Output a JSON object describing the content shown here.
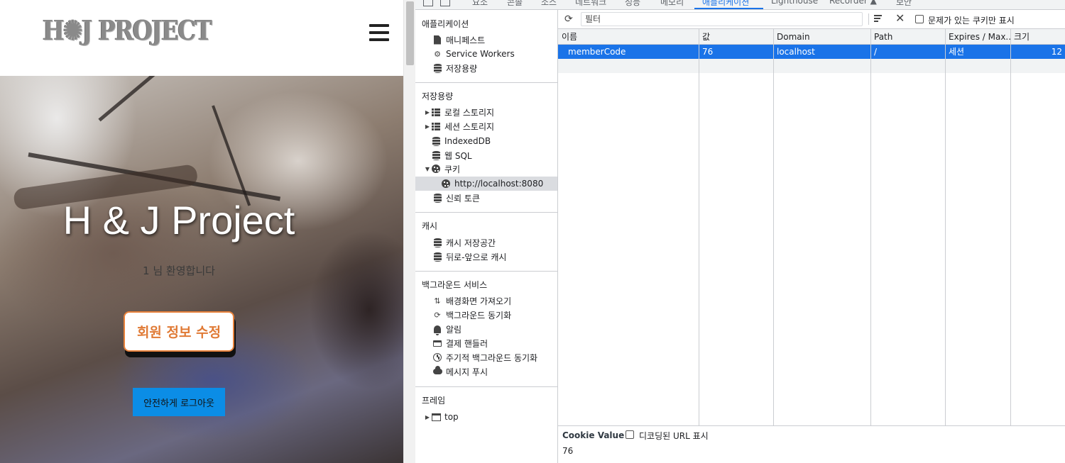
{
  "site": {
    "logo_text": "H✺J PROJECT",
    "hero_title": "H & J Project",
    "welcome": "1 님 환영합니다",
    "edit_button": "회원 정보 수정",
    "logout_button": "안전하게 로그아웃"
  },
  "devtools": {
    "tabs": [
      "요소",
      "콘솔",
      "소스",
      "네트워크",
      "성능",
      "메모리",
      "애플리케이션",
      "Lighthouse",
      "Recorder ▲",
      "보안"
    ],
    "active_tab": "애플리케이션",
    "sidebar": {
      "app_title": "애플리케이션",
      "app_items": [
        "매니페스트",
        "Service Workers",
        "저장용량"
      ],
      "storage_title": "저장용량",
      "storage_items": [
        "로컬 스토리지",
        "세션 스토리지",
        "IndexedDB",
        "웹 SQL",
        "쿠키",
        "http://localhost:8080",
        "신뢰 토큰"
      ],
      "cache_title": "캐시",
      "cache_items": [
        "캐시 저장공간",
        "뒤로-앞으로 캐시"
      ],
      "bg_title": "백그라운드 서비스",
      "bg_items": [
        "배경화면 가져오기",
        "백그라운드 동기화",
        "알림",
        "결제 핸들러",
        "주기적 백그라운드 동기화",
        "메시지 푸시"
      ],
      "frames_title": "프레임",
      "frames_items": [
        "top"
      ]
    },
    "toolbar": {
      "filter_placeholder": "필터",
      "issue_label": "문제가 있는 쿠키만 표시"
    },
    "table": {
      "columns": [
        "이름",
        "값",
        "Domain",
        "Path",
        "Expires / Max...",
        "크기"
      ],
      "rows": [
        {
          "name": "memberCode",
          "value": "76",
          "domain": "localhost",
          "path": "/",
          "expires": "세션",
          "size": "12"
        }
      ]
    },
    "cookie_value": {
      "title": "Cookie Value",
      "decode_label": "디코딩된 URL 표시",
      "value": "76"
    }
  },
  "colors": {
    "accent": "#1a73e8",
    "edit_button": "#e07a35",
    "logout_button": "#0b8de6"
  }
}
